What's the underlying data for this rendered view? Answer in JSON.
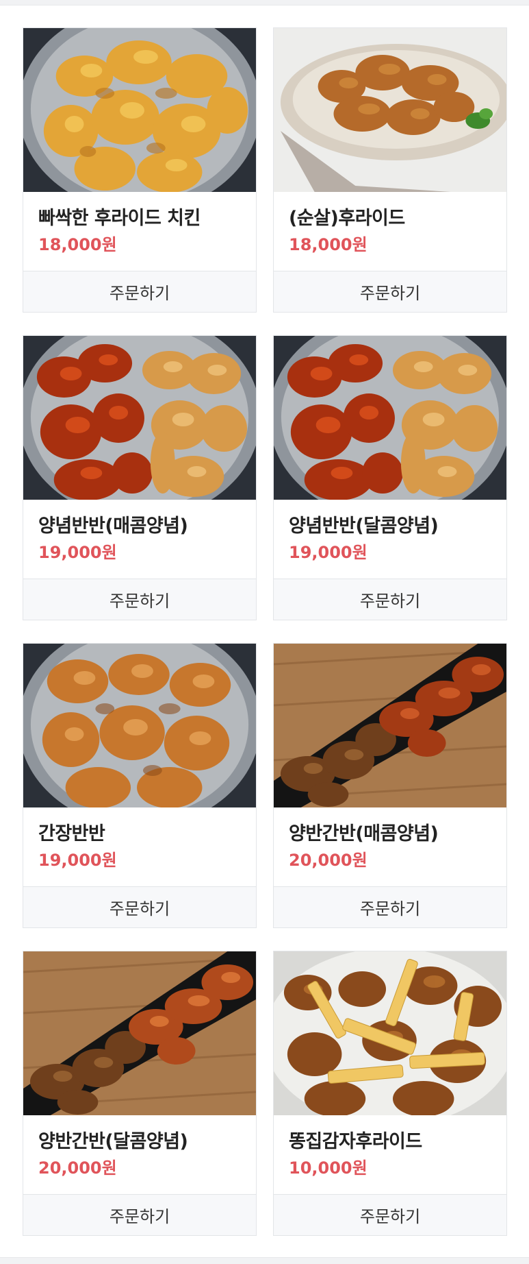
{
  "order_label": "주문하기",
  "accent_price_color": "#e0545a",
  "products": [
    {
      "name": "빠싹한 후라이드 치킨",
      "price": "18,000원",
      "image": "fried-chicken-on-steel-plate"
    },
    {
      "name": "(순살)후라이드",
      "price": "18,000원",
      "image": "boneless-fried-chicken-on-beige-plate"
    },
    {
      "name": "양념반반(매콤양념)",
      "price": "19,000원",
      "image": "half-spicy-half-fried-on-steel-plate"
    },
    {
      "name": "양념반반(달콤양념)",
      "price": "19,000원",
      "image": "half-sweet-half-fried-on-steel-plate"
    },
    {
      "name": "간장반반",
      "price": "19,000원",
      "image": "soy-sauce-half-chicken-on-steel-plate"
    },
    {
      "name": "양반간반(매콤양념)",
      "price": "20,000원",
      "image": "boneless-spicy-soy-on-black-tray"
    },
    {
      "name": "양반간반(달콤양념)",
      "price": "20,000원",
      "image": "boneless-sweet-soy-on-black-tray"
    },
    {
      "name": "똥집감자후라이드",
      "price": "10,000원",
      "image": "gizzards-and-fries-on-white-plate"
    }
  ]
}
